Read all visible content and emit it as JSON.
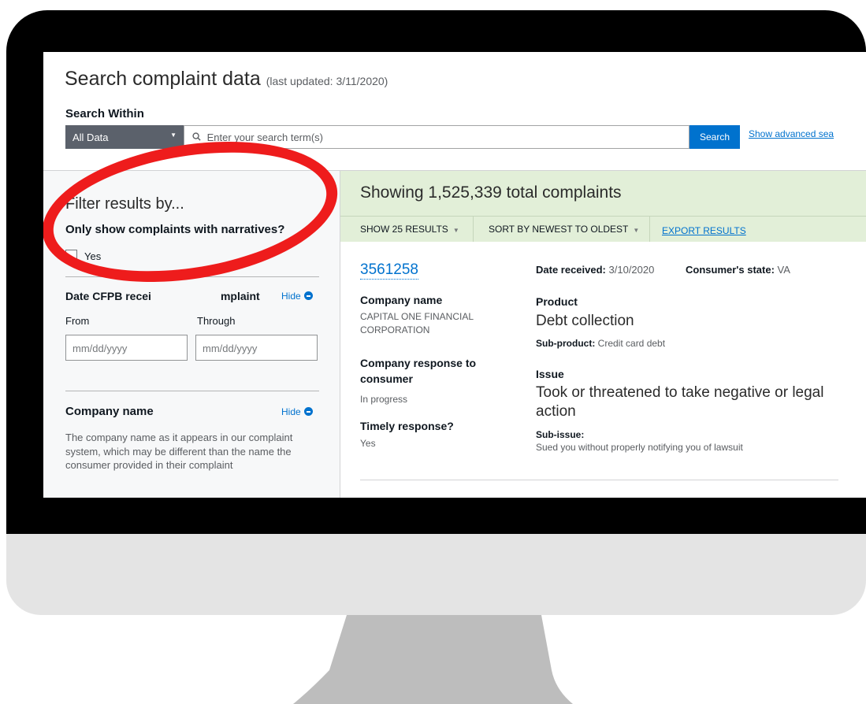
{
  "header": {
    "title": "Search complaint data",
    "last_updated": "(last updated: 3/11/2020)",
    "search_within_label": "Search Within",
    "scope_value": "All Data",
    "search_placeholder": "Enter your search term(s)",
    "search_button": "Search",
    "advanced_link": "Show advanced sea"
  },
  "filters": {
    "heading": "Filter results by...",
    "narratives_question": "Only show complaints with narratives?",
    "yes_label": "Yes",
    "date_heading": "Date CFPB received the complaint",
    "date_heading_visible": "Date CFPB recei",
    "date_heading_tail": "mplaint",
    "hide_label": "Hide",
    "from_label": "From",
    "through_label": "Through",
    "date_placeholder": "mm/dd/yyyy",
    "company_heading": "Company name",
    "company_description": "The company name as it appears in our complaint system, which may be different than the name the consumer provided in their complaint"
  },
  "results": {
    "count_text": "Showing 1,525,339 total complaints",
    "show_results": "SHOW 25 RESULTS",
    "sort": "SORT BY NEWEST TO OLDEST",
    "export": "EXPORT RESULTS"
  },
  "complaint": {
    "id": "3561258",
    "date_received_label": "Date received:",
    "date_received": "3/10/2020",
    "state_label": "Consumer's state:",
    "state": "VA",
    "company_name_label": "Company name",
    "company_name": "CAPITAL ONE FINANCIAL CORPORATION",
    "company_name_line1": "CAPITAL ONE FINANCIAL",
    "company_name_line2": "CORPORATION",
    "company_response_label": "Company response to consumer",
    "company_response": "In progress",
    "timely_label": "Timely response?",
    "timely": "Yes",
    "product_label": "Product",
    "product": "Debt collection",
    "sub_product_label": "Sub-product:",
    "sub_product": "Credit card debt",
    "issue_label": "Issue",
    "issue": "Took or threatened to take negative or legal action",
    "sub_issue_label": "Sub-issue:",
    "sub_issue": "Sued you without properly notifying you of lawsuit"
  },
  "icons": {
    "search": "search-icon",
    "hide": "minus-circle-icon",
    "caret": "caret-down-icon"
  },
  "colors": {
    "accent": "#0072ce",
    "results_header": "#e2efd8",
    "annotation": "#ee1c1c",
    "bezel": "#000000"
  }
}
